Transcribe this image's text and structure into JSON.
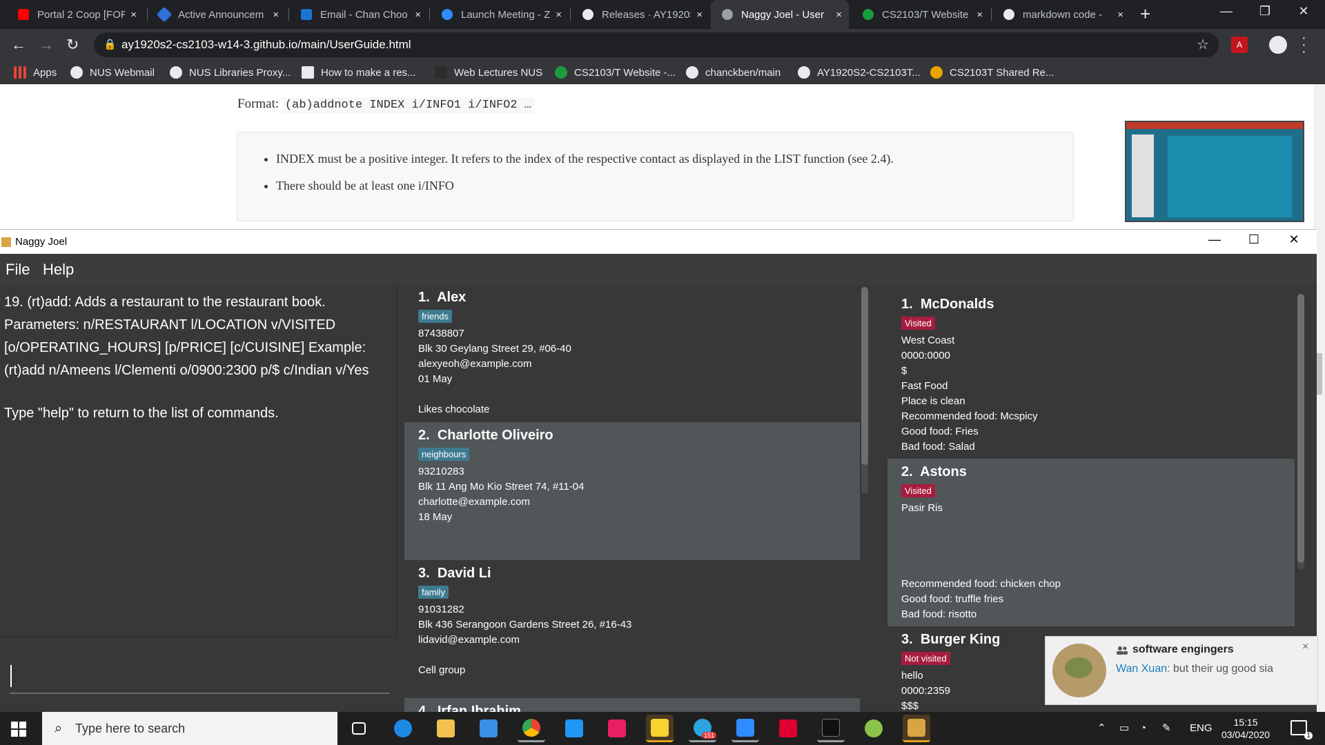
{
  "browser": {
    "tabs": [
      {
        "title": "Portal 2 Coop [FOR",
        "favicon_color": "#ff0000",
        "active": false
      },
      {
        "title": "Active Announcem",
        "favicon_color": "#2f6fd8",
        "active": false
      },
      {
        "title": "Email - Chan Choo",
        "favicon_color": "#1976d2",
        "active": false
      },
      {
        "title": "Launch Meeting - Z",
        "favicon_color": "#2d8cff",
        "active": false
      },
      {
        "title": "Releases · AY1920S",
        "favicon_color": "#e8eaed",
        "active": false
      },
      {
        "title": "Naggy Joel - User",
        "favicon_color": "#9aa0a6",
        "active": true
      },
      {
        "title": "CS2103/T Website",
        "favicon_color": "#1a9c3e",
        "active": false
      },
      {
        "title": "markdown code -",
        "favicon_color": "#e8eaed",
        "active": false
      }
    ],
    "close_glyph": "×",
    "new_tab_glyph": "+",
    "url": "ay1920s2-cs2103-w14-3.github.io/main/UserGuide.html",
    "bookmarks": [
      {
        "label": "Apps",
        "icon_color": "#ea4335"
      },
      {
        "label": "NUS Webmail",
        "icon_color": "#e8eaed"
      },
      {
        "label": "NUS Libraries Proxy...",
        "icon_color": "#e8eaed"
      },
      {
        "label": "How to make a res...",
        "icon_color": "#e8eaed"
      },
      {
        "label": "Web Lectures NUS",
        "icon_color": "#35363a"
      },
      {
        "label": "CS2103/T Website -...",
        "icon_color": "#1a9c3e"
      },
      {
        "label": "chanckben/main",
        "icon_color": "#e8eaed"
      },
      {
        "label": "AY1920S2-CS2103T...",
        "icon_color": "#e8eaed"
      },
      {
        "label": "CS2103T Shared Re...",
        "icon_color": "#e8a400"
      }
    ]
  },
  "page": {
    "format_label": "Format:",
    "format_code": "(ab)addnote INDEX i/INFO1 i/INFO2 …",
    "notes": [
      "INDEX must be a positive integer. It refers to the index of the respective contact as displayed in the LIST function (see 2.4).",
      "There should be at least one i/INFO"
    ]
  },
  "app": {
    "title": "Naggy Joel",
    "menu": [
      "File",
      "Help"
    ],
    "result_text": [
      "19. (rt)add: Adds a restaurant to the restaurant book. Parameters: n/RESTAURANT l/LOCATION v/VISITED [o/OPERATING_HOURS] [p/PRICE] [c/CUISINE] Example: (rt)add n/Ameens l/Clementi o/0900:2300 p/$ c/Indian v/Yes",
      "Type \"help\" to return to the list of commands."
    ],
    "command_value": "",
    "contacts": [
      {
        "index": "1.",
        "name": "Alex",
        "tag": "friends",
        "phone": "87438807",
        "address": "Blk 30 Geylang Street 29, #06-40",
        "email": "alexyeoh@example.com",
        "birthday": "01 May",
        "remark": "Likes chocolate"
      },
      {
        "index": "2.",
        "name": "Charlotte Oliveiro",
        "tag": "neighbours",
        "phone": "93210283",
        "address": "Blk 11 Ang Mo Kio Street 74, #11-04",
        "email": "charlotte@example.com",
        "birthday": "18 May",
        "remark": ""
      },
      {
        "index": "3.",
        "name": "David Li",
        "tag": "family",
        "phone": "91031282",
        "address": "Blk 436 Serangoon Gardens Street 26, #16-43",
        "email": "lidavid@example.com",
        "birthday": "",
        "remark": "Cell group"
      },
      {
        "index": "4.",
        "name": "Irfan Ibrahim",
        "tag": "",
        "phone": "",
        "address": "",
        "email": "",
        "birthday": "",
        "remark": ""
      }
    ],
    "restaurants": [
      {
        "index": "1.",
        "name": "McDonalds",
        "status": "Visited",
        "lines": [
          "West Coast",
          "0000:0000",
          "$",
          "Fast Food",
          "Place is clean",
          "Recommended food: Mcspicy",
          "Good food: Fries",
          "Bad food: Salad"
        ]
      },
      {
        "index": "2.",
        "name": "Astons",
        "status": "Visited",
        "lines": [
          "Pasir Ris",
          "",
          "",
          "",
          "",
          "Recommended food: chicken chop",
          "Good food: truffle fries",
          "Bad food: risotto"
        ]
      },
      {
        "index": "3.",
        "name": "Burger King",
        "status": "Not visited",
        "lines": [
          "hello",
          "0000:2359",
          "$$$"
        ]
      }
    ]
  },
  "toast": {
    "group": "software engingers",
    "sender": "Wan Xuan:",
    "message": "but their ug good sia",
    "close_glyph": "×"
  },
  "taskbar": {
    "search_placeholder": "Type here to search",
    "badge": "151",
    "lang": "ENG",
    "time": "15:15",
    "date": "03/04/2020",
    "notif_count": "1"
  }
}
